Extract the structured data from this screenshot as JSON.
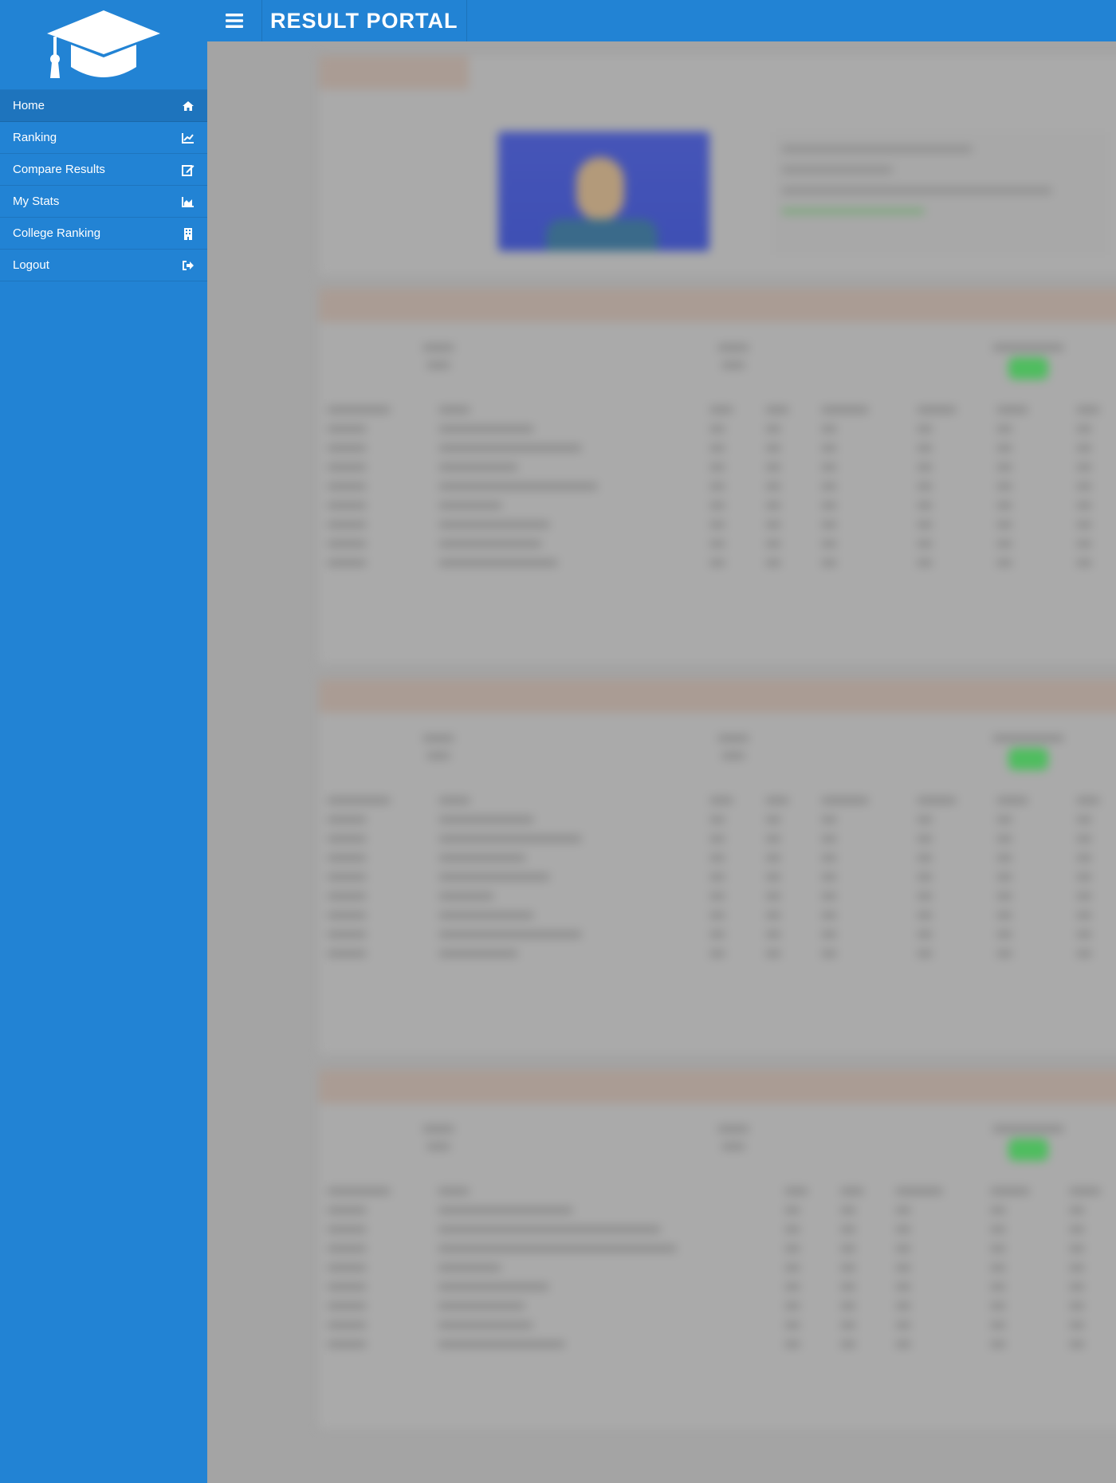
{
  "app": {
    "title": "RESULT PORTAL",
    "accent_color": "#2283d4",
    "logo_icon": "graduation-cap-icon",
    "menu_icon": "hamburger-menu-icon"
  },
  "sidebar": {
    "items": [
      {
        "label": "Home",
        "icon": "home-icon",
        "active": true
      },
      {
        "label": "Ranking",
        "icon": "line-chart-icon",
        "active": false
      },
      {
        "label": "Compare Results",
        "icon": "edit-icon",
        "active": false
      },
      {
        "label": "My Stats",
        "icon": "area-chart-icon",
        "active": false
      },
      {
        "label": "College Ranking",
        "icon": "building-icon",
        "active": false
      },
      {
        "label": "Logout",
        "icon": "sign-out-icon",
        "active": false
      }
    ]
  }
}
